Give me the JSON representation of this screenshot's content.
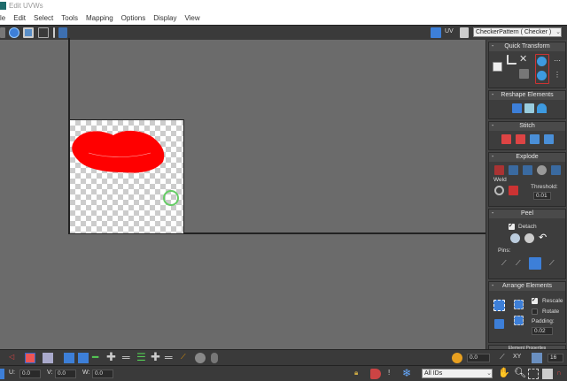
{
  "window": {
    "title": "Edit UVWs"
  },
  "menu": [
    "le",
    "Edit",
    "Select",
    "Tools",
    "Mapping",
    "Options",
    "Display",
    "View"
  ],
  "toolbar": {
    "uv_label": "UV",
    "texture_select": "CheckerPattern  ( Checker )"
  },
  "panel": {
    "quick_transform": "Quick Transform",
    "reshape": "Reshape Elements",
    "stitch": "Stitch",
    "explode": "Explode",
    "weld": "Weld",
    "threshold_label": "Threshold:",
    "threshold": "0.01",
    "peel": "Peel",
    "detach": "Detach",
    "detach_checked": true,
    "pins": "Pins:",
    "arrange": "Arrange Elements",
    "rescale": "Rescale",
    "rescale_checked": true,
    "rotate": "Rotate",
    "rotate_checked": false,
    "padding_label": "Padding:",
    "padding": "0.02",
    "element_props": "Element Properties"
  },
  "bottom": {
    "soft_value": "0.0",
    "xy_label": "XY",
    "grid_value": "16",
    "u_label": "U:",
    "u_value": "0.0",
    "v_label": "V:",
    "v_value": "0.0",
    "w_label": "W:",
    "w_value": "0.0",
    "ids_select": "All IDs"
  },
  "colors": {
    "accent": "#3d7fd8",
    "lips": "#ff0000",
    "viewport": "#6b6b6b"
  }
}
